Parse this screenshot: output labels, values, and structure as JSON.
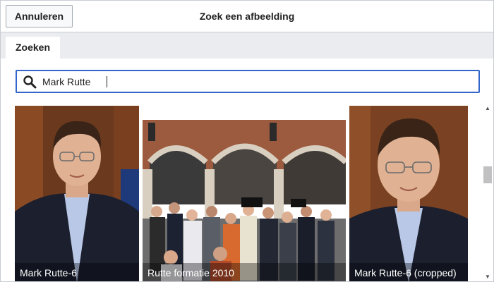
{
  "header": {
    "cancel_label": "Annuleren",
    "title": "Zoek een afbeelding"
  },
  "tabs": [
    {
      "label": "Zoeken"
    }
  ],
  "search": {
    "value": "Mark Rutte",
    "icon": "search-icon"
  },
  "results": [
    {
      "caption": "Mark Rutte-6"
    },
    {
      "caption": "Rutte formatie 2010"
    },
    {
      "caption": "Mark Rutte-6 (cropped)"
    }
  ],
  "colors": {
    "accent": "#3366cc",
    "border": "#c8ccd1",
    "tabbar": "#eaecf0"
  }
}
